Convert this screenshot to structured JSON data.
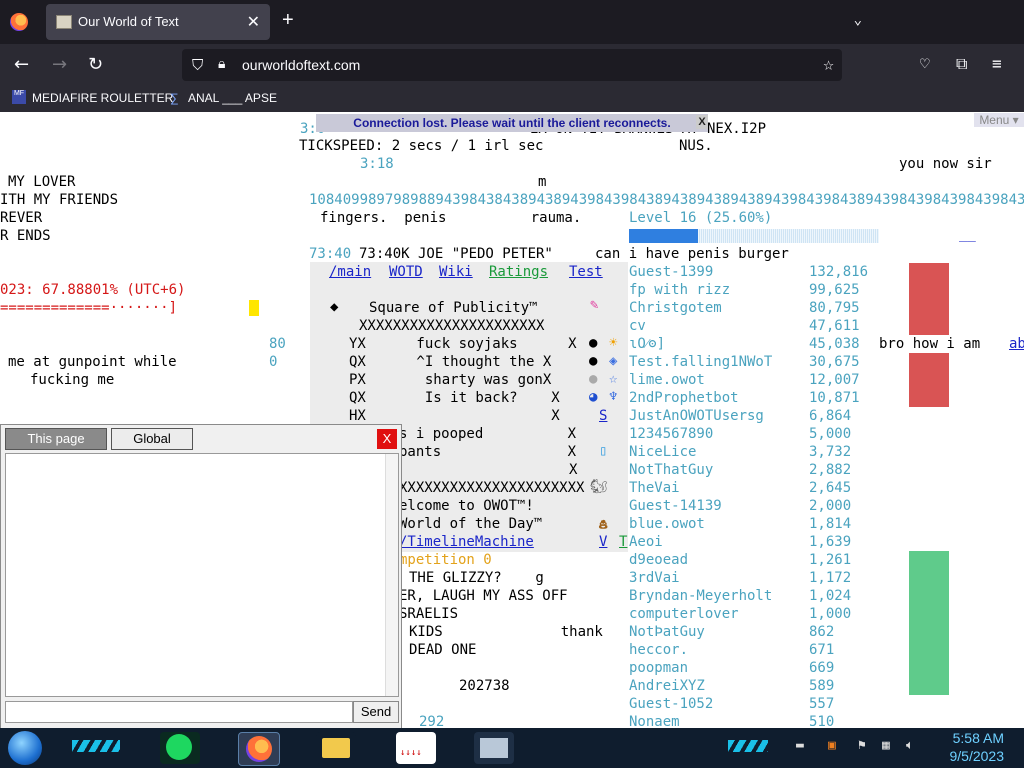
{
  "browser": {
    "tab_title": "Our World of Text",
    "new_tab": "+",
    "tab_close": "✕",
    "url": "ourworldoftext.com",
    "bookmarks": [
      "MEDIAFIRE ROULETTER",
      "ANAL ___ APSE"
    ]
  },
  "page": {
    "connection_banner": "Connection lost. Please wait until the client reconnects.",
    "connection_close": "X",
    "menu_label": "Menu ▾",
    "tickspeed": "TICKSPEED: 2 secs / 1 irl sec",
    "nus": "NUS.",
    "top_timer": "3:0",
    "top_right_text": "EX ON TIT BARNWLS AT NEX.I2P",
    "timer_318": "3:18",
    "you_now_sir": "you now sir",
    "m_char": "m",
    "left_lines": [
      "MY LOVER",
      "ITH MY FRIENDS",
      "REVER",
      "R ENDS"
    ],
    "long_number": "108409989798988943984384389438943984398438943894389438943984398438943984398439843984398438",
    "fingers_line": "fingers.  penis          rauma.",
    "level_label": "Level 16 (25.60%)",
    "level_progress": 0.256,
    "clock_percent": "023: 67.88801% (UTC+6)",
    "progress_line": "=============·······]",
    "joe_line": "73:40K JOE \"PEDO PETER\"     can i have penis burger",
    "nav_links": [
      "/main",
      "WOTD",
      "Wiki",
      "Ratings",
      "Test"
    ],
    "square_title": "Square of Publicity™",
    "x_row": "XXXXXXXXXXXXXXXXXXXXXX",
    "square_lines": [
      "YX      fuck soyjaks      X",
      "QX      ^I thought the X",
      "PX       sharty was gonX",
      "QX       Is it back?    X",
      "HX                      X"
    ],
    "pooped": "s i pooped          X",
    "pants": "pants               X",
    "x_right": "X",
    "welcome": "elcome to OWOT™!",
    "wotd": "World of the Day™",
    "timeline": "/TimelineMachine",
    "competition": "mpetition 0",
    "glizzy": "THE GLIZZY?    g",
    "laugh": "ER, LAUGH MY ASS OFF",
    "sraelis": "SRAELIS",
    "kids": "KIDS              thank",
    "dead_one": "DEAD ONE",
    "num_202738": "202738",
    "num_292": "292",
    "num_80": "80",
    "num_0": "0",
    "gunpoint": "me at gunpoint while",
    "fucking_me": "fucking me",
    "bro_how": "bro how i am",
    "bro_link": "ab",
    "s_link": "S",
    "v_link": "V",
    "t_link": "T",
    "leaderboard": [
      {
        "name": "Guest-1399",
        "score": "132,816"
      },
      {
        "name": "fp with rizz",
        "score": "99,625"
      },
      {
        "name": "Christgotem",
        "score": "80,795"
      },
      {
        "name": "cv",
        "score": "47,611"
      },
      {
        "name": "ɩO⁄ʘ]",
        "score": "45,038"
      },
      {
        "name": "Test.falling1NWoT",
        "score": "30,675"
      },
      {
        "name": "lime.owot",
        "score": "12,007"
      },
      {
        "name": "2ndProphetbot",
        "score": "10,871"
      },
      {
        "name": "JustAnOWOTUsersg",
        "score": "6,864"
      },
      {
        "name": "1234567890",
        "score": "5,000"
      },
      {
        "name": "NiceLice",
        "score": "3,732"
      },
      {
        "name": "NotThatGuy",
        "score": "2,882"
      },
      {
        "name": "TheVai",
        "score": "2,645"
      },
      {
        "name": "Guest-14139",
        "score": "2,000"
      },
      {
        "name": "blue.owot",
        "score": "1,814"
      },
      {
        "name": "Aeoi",
        "score": "1,639"
      },
      {
        "name": "d9eoead",
        "score": "1,261"
      },
      {
        "name": "3rdVai",
        "score": "1,172"
      },
      {
        "name": "Bryndan-Meyerholt",
        "score": "1,024"
      },
      {
        "name": "computerlover",
        "score": "1,000"
      },
      {
        "name": "NotÞatGuy",
        "score": "862"
      },
      {
        "name": "heccor.",
        "score": "671"
      },
      {
        "name": "poopman",
        "score": "669"
      },
      {
        "name": "AndreiXYZ",
        "score": "589"
      },
      {
        "name": "Guest-1052",
        "score": "557"
      },
      {
        "name": "Nonaem",
        "score": "510"
      }
    ]
  },
  "chat": {
    "tab_this_page": "This page",
    "tab_global": "Global",
    "close": "X",
    "send": "Send",
    "input_value": ""
  },
  "taskbar": {
    "time": "5:58 AM",
    "date": "9/5/2023"
  },
  "colors": {
    "teal": "#4aa3bf",
    "red_bar": "#d95454",
    "green_bar": "#5fcb8b",
    "level_fill": "#2f7fe0"
  }
}
